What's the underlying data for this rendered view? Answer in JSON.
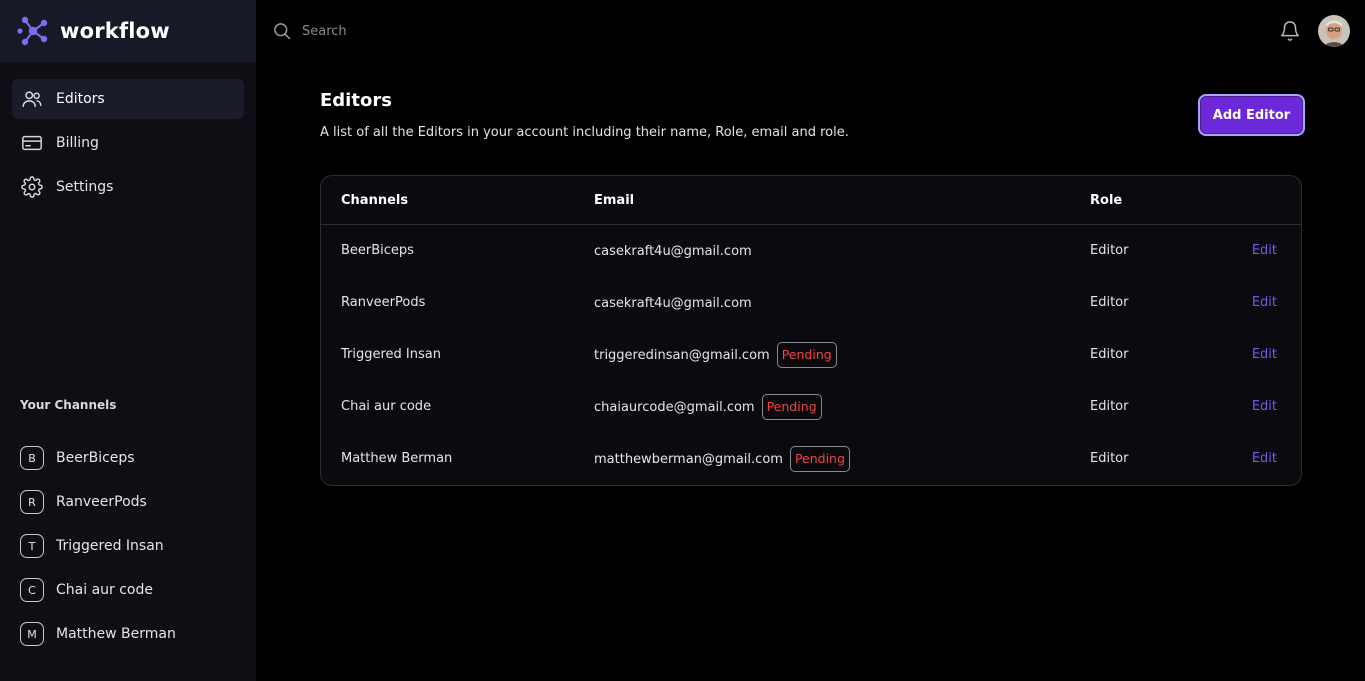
{
  "brand": {
    "name": "workflow"
  },
  "nav": {
    "items": [
      {
        "label": "Editors",
        "icon": "users-icon",
        "active": true
      },
      {
        "label": "Billing",
        "icon": "credit-card-icon",
        "active": false
      },
      {
        "label": "Settings",
        "icon": "gear-icon",
        "active": false
      }
    ]
  },
  "channels": {
    "title": "Your Channels",
    "items": [
      {
        "initial": "B",
        "label": "BeerBiceps"
      },
      {
        "initial": "R",
        "label": "RanveerPods"
      },
      {
        "initial": "T",
        "label": "Triggered Insan"
      },
      {
        "initial": "C",
        "label": "Chai aur code"
      },
      {
        "initial": "M",
        "label": "Matthew Berman"
      }
    ]
  },
  "search": {
    "placeholder": "Search"
  },
  "page": {
    "title": "Editors",
    "description": "A list of all the Editors in your account including their name, Role, email and role.",
    "add_button": "Add Editor"
  },
  "table": {
    "headers": {
      "channel": "Channels",
      "email": "Email",
      "role": "Role"
    },
    "rows": [
      {
        "channel": "BeerBiceps",
        "email": "casekraft4u@gmail.com",
        "status": "",
        "role": "Editor",
        "action": "Edit"
      },
      {
        "channel": "RanveerPods",
        "email": "casekraft4u@gmail.com",
        "status": "",
        "role": "Editor",
        "action": "Edit"
      },
      {
        "channel": "Triggered Insan",
        "email": "triggeredinsan@gmail.com",
        "status": "Pending",
        "role": "Editor",
        "action": "Edit"
      },
      {
        "channel": "Chai aur code",
        "email": "chaiaurcode@gmail.com",
        "status": "Pending",
        "role": "Editor",
        "action": "Edit"
      },
      {
        "channel": "Matthew Berman",
        "email": "matthewberman@gmail.com",
        "status": "Pending",
        "role": "Editor",
        "action": "Edit"
      }
    ]
  },
  "colors": {
    "accent": "#6d28d9",
    "link": "#6d5ee8",
    "pending": "#f04444",
    "sidebar_bg": "#0e0e14",
    "brand_bg": "#161a26"
  }
}
